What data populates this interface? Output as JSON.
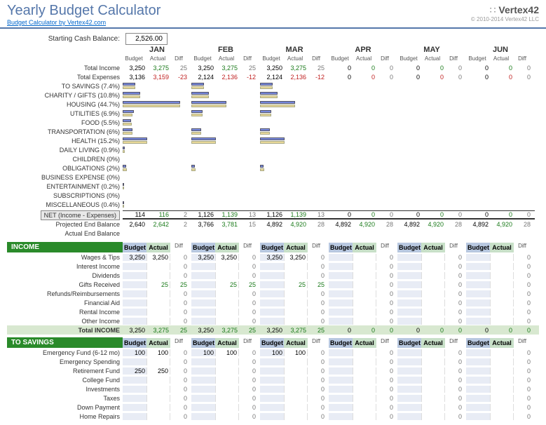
{
  "title": "Yearly Budget Calculator",
  "sublink": "Budget Calculator by Vertex42.com",
  "logo": "Vertex42",
  "copyright": "© 2010-2014 Vertex42 LLC",
  "cash_label": "Starting Cash Balance:",
  "cash_value": "2,526.00",
  "months": [
    "JAN",
    "FEB",
    "MAR",
    "APR",
    "MAY",
    "JUN"
  ],
  "col_labels": {
    "b": "Budget",
    "a": "Actual",
    "d": "Diff"
  },
  "summary": {
    "income_label": "Total Income",
    "expense_label": "Total Expenses",
    "income": [
      {
        "b": "3,250",
        "a": "3,275",
        "d": "25"
      },
      {
        "b": "3,250",
        "a": "3,275",
        "d": "25"
      },
      {
        "b": "3,250",
        "a": "3,275",
        "d": "25"
      },
      {
        "b": "0",
        "a": "0",
        "d": "0"
      },
      {
        "b": "0",
        "a": "0",
        "d": "0"
      },
      {
        "b": "0",
        "a": "0",
        "d": "0"
      }
    ],
    "expense": [
      {
        "b": "3,136",
        "a": "3,159",
        "d": "-23"
      },
      {
        "b": "2,124",
        "a": "2,136",
        "d": "-12"
      },
      {
        "b": "2,124",
        "a": "2,136",
        "d": "-12"
      },
      {
        "b": "0",
        "a": "0",
        "d": "0"
      },
      {
        "b": "0",
        "a": "0",
        "d": "0"
      },
      {
        "b": "0",
        "a": "0",
        "d": "0"
      }
    ]
  },
  "categories": [
    {
      "name": "TO SAVINGS (7.4%)",
      "bars": [
        [
          18,
          18
        ],
        [
          18,
          18
        ],
        [
          18,
          18
        ]
      ]
    },
    {
      "name": "CHARITY / GIFTS (10.8%)",
      "bars": [
        [
          25,
          25
        ],
        [
          25,
          25
        ],
        [
          25,
          25
        ]
      ]
    },
    {
      "name": "HOUSING (44.7%)",
      "bars": [
        [
          82,
          82
        ],
        [
          50,
          50
        ],
        [
          50,
          50
        ]
      ]
    },
    {
      "name": "UTILITIES (6.9%)",
      "bars": [
        [
          16,
          14
        ],
        [
          16,
          16
        ],
        [
          16,
          16
        ]
      ]
    },
    {
      "name": "FOOD (5.5%)",
      "bars": [
        [
          12,
          13
        ],
        [
          0,
          0
        ],
        [
          0,
          0
        ]
      ]
    },
    {
      "name": "TRANSPORTATION (6%)",
      "bars": [
        [
          14,
          14
        ],
        [
          14,
          14
        ],
        [
          14,
          14
        ]
      ]
    },
    {
      "name": "HEALTH (15.2%)",
      "bars": [
        [
          35,
          35
        ],
        [
          35,
          35
        ],
        [
          35,
          35
        ]
      ]
    },
    {
      "name": "DAILY LIVING (0.9%)",
      "bars": [
        [
          3,
          3
        ],
        [
          0,
          0
        ],
        [
          0,
          0
        ]
      ]
    },
    {
      "name": "CHILDREN (0%)",
      "bars": [
        [
          0,
          0
        ],
        [
          0,
          0
        ],
        [
          0,
          0
        ]
      ]
    },
    {
      "name": "OBLIGATIONS (2%)",
      "bars": [
        [
          5,
          6
        ],
        [
          5,
          6
        ],
        [
          5,
          6
        ]
      ]
    },
    {
      "name": "BUSINESS EXPENSE (0%)",
      "bars": [
        [
          0,
          0
        ],
        [
          0,
          0
        ],
        [
          0,
          0
        ]
      ]
    },
    {
      "name": "ENTERTAINMENT (0.2%)",
      "bars": [
        [
          2,
          2
        ],
        [
          0,
          0
        ],
        [
          0,
          0
        ]
      ]
    },
    {
      "name": "SUBSCRIPTIONS (0%)",
      "bars": [
        [
          0,
          0
        ],
        [
          0,
          0
        ],
        [
          0,
          0
        ]
      ]
    },
    {
      "name": "MISCELLANEOUS (0.4%)",
      "bars": [
        [
          2,
          2
        ],
        [
          0,
          0
        ],
        [
          0,
          0
        ]
      ]
    }
  ],
  "net": {
    "label": "NET (Income - Expenses)",
    "proj_label": "Projected End Balance",
    "act_label": "Actual End Balance",
    "rows": [
      {
        "b": "114",
        "a": "116",
        "d": "2"
      },
      {
        "b": "1,126",
        "a": "1,139",
        "d": "13"
      },
      {
        "b": "1,126",
        "a": "1,139",
        "d": "13"
      },
      {
        "b": "0",
        "a": "0",
        "d": "0"
      },
      {
        "b": "0",
        "a": "0",
        "d": "0"
      },
      {
        "b": "0",
        "a": "0",
        "d": "0"
      }
    ],
    "proj": [
      {
        "b": "2,640",
        "a": "2,642",
        "d": "2"
      },
      {
        "b": "3,766",
        "a": "3,781",
        "d": "15"
      },
      {
        "b": "4,892",
        "a": "4,920",
        "d": "28"
      },
      {
        "b": "4,892",
        "a": "4,920",
        "d": "28"
      },
      {
        "b": "4,892",
        "a": "4,920",
        "d": "28"
      },
      {
        "b": "4,892",
        "a": "4,920",
        "d": "28"
      }
    ]
  },
  "income_section": {
    "title": "INCOME",
    "total_label": "Total INCOME",
    "items": [
      "Wages & Tips",
      "Interest Income",
      "Dividends",
      "Gifts Received",
      "Refunds/Reimbursements",
      "Financial Aid",
      "Rental Income",
      "Other Income"
    ],
    "data": [
      [
        {
          "b": "3,250",
          "a": "3,250",
          "d": "0"
        },
        {
          "b": "3,250",
          "a": "3,250",
          "d": "0"
        },
        {
          "b": "3,250",
          "a": "3,250",
          "d": "0"
        },
        {
          "b": "",
          "a": "",
          "d": "0"
        },
        {
          "b": "",
          "a": "",
          "d": "0"
        },
        {
          "b": "",
          "a": "",
          "d": "0"
        }
      ],
      [
        {
          "b": "",
          "a": "",
          "d": "0"
        },
        {
          "b": "",
          "a": "",
          "d": "0"
        },
        {
          "b": "",
          "a": "",
          "d": "0"
        },
        {
          "b": "",
          "a": "",
          "d": "0"
        },
        {
          "b": "",
          "a": "",
          "d": "0"
        },
        {
          "b": "",
          "a": "",
          "d": "0"
        }
      ],
      [
        {
          "b": "",
          "a": "",
          "d": "0"
        },
        {
          "b": "",
          "a": "",
          "d": "0"
        },
        {
          "b": "",
          "a": "",
          "d": "0"
        },
        {
          "b": "",
          "a": "",
          "d": "0"
        },
        {
          "b": "",
          "a": "",
          "d": "0"
        },
        {
          "b": "",
          "a": "",
          "d": "0"
        }
      ],
      [
        {
          "b": "",
          "a": "25",
          "d": "25"
        },
        {
          "b": "",
          "a": "25",
          "d": "25"
        },
        {
          "b": "",
          "a": "25",
          "d": "25"
        },
        {
          "b": "",
          "a": "",
          "d": "0"
        },
        {
          "b": "",
          "a": "",
          "d": "0"
        },
        {
          "b": "",
          "a": "",
          "d": "0"
        }
      ],
      [
        {
          "b": "",
          "a": "",
          "d": "0"
        },
        {
          "b": "",
          "a": "",
          "d": "0"
        },
        {
          "b": "",
          "a": "",
          "d": "0"
        },
        {
          "b": "",
          "a": "",
          "d": "0"
        },
        {
          "b": "",
          "a": "",
          "d": "0"
        },
        {
          "b": "",
          "a": "",
          "d": "0"
        }
      ],
      [
        {
          "b": "",
          "a": "",
          "d": "0"
        },
        {
          "b": "",
          "a": "",
          "d": "0"
        },
        {
          "b": "",
          "a": "",
          "d": "0"
        },
        {
          "b": "",
          "a": "",
          "d": "0"
        },
        {
          "b": "",
          "a": "",
          "d": "0"
        },
        {
          "b": "",
          "a": "",
          "d": "0"
        }
      ],
      [
        {
          "b": "",
          "a": "",
          "d": "0"
        },
        {
          "b": "",
          "a": "",
          "d": "0"
        },
        {
          "b": "",
          "a": "",
          "d": "0"
        },
        {
          "b": "",
          "a": "",
          "d": "0"
        },
        {
          "b": "",
          "a": "",
          "d": "0"
        },
        {
          "b": "",
          "a": "",
          "d": "0"
        }
      ],
      [
        {
          "b": "",
          "a": "",
          "d": "0"
        },
        {
          "b": "",
          "a": "",
          "d": "0"
        },
        {
          "b": "",
          "a": "",
          "d": "0"
        },
        {
          "b": "",
          "a": "",
          "d": "0"
        },
        {
          "b": "",
          "a": "",
          "d": "0"
        },
        {
          "b": "",
          "a": "",
          "d": "0"
        }
      ]
    ],
    "totals": [
      {
        "b": "3,250",
        "a": "3,275",
        "d": "25"
      },
      {
        "b": "3,250",
        "a": "3,275",
        "d": "25"
      },
      {
        "b": "3,250",
        "a": "3,275",
        "d": "25"
      },
      {
        "b": "0",
        "a": "0",
        "d": "0"
      },
      {
        "b": "0",
        "a": "0",
        "d": "0"
      },
      {
        "b": "0",
        "a": "0",
        "d": "0"
      }
    ]
  },
  "savings_section": {
    "title": "TO SAVINGS",
    "items": [
      "Emergency Fund (6-12 mo)",
      "Emergency Spending",
      "Retirement Fund",
      "College Fund",
      "Investments",
      "Taxes",
      "Down Payment",
      "Home Repairs"
    ],
    "data": [
      [
        {
          "b": "100",
          "a": "100",
          "d": "0"
        },
        {
          "b": "100",
          "a": "100",
          "d": "0"
        },
        {
          "b": "100",
          "a": "100",
          "d": "0"
        },
        {
          "b": "",
          "a": "",
          "d": "0"
        },
        {
          "b": "",
          "a": "",
          "d": "0"
        },
        {
          "b": "",
          "a": "",
          "d": "0"
        }
      ],
      [
        {
          "b": "",
          "a": "",
          "d": "0"
        },
        {
          "b": "",
          "a": "",
          "d": "0"
        },
        {
          "b": "",
          "a": "",
          "d": "0"
        },
        {
          "b": "",
          "a": "",
          "d": "0"
        },
        {
          "b": "",
          "a": "",
          "d": "0"
        },
        {
          "b": "",
          "a": "",
          "d": "0"
        }
      ],
      [
        {
          "b": "250",
          "a": "250",
          "d": "0"
        },
        {
          "b": "",
          "a": "",
          "d": "0"
        },
        {
          "b": "",
          "a": "",
          "d": "0"
        },
        {
          "b": "",
          "a": "",
          "d": "0"
        },
        {
          "b": "",
          "a": "",
          "d": "0"
        },
        {
          "b": "",
          "a": "",
          "d": "0"
        }
      ],
      [
        {
          "b": "",
          "a": "",
          "d": "0"
        },
        {
          "b": "",
          "a": "",
          "d": "0"
        },
        {
          "b": "",
          "a": "",
          "d": "0"
        },
        {
          "b": "",
          "a": "",
          "d": "0"
        },
        {
          "b": "",
          "a": "",
          "d": "0"
        },
        {
          "b": "",
          "a": "",
          "d": "0"
        }
      ],
      [
        {
          "b": "",
          "a": "",
          "d": "0"
        },
        {
          "b": "",
          "a": "",
          "d": "0"
        },
        {
          "b": "",
          "a": "",
          "d": "0"
        },
        {
          "b": "",
          "a": "",
          "d": "0"
        },
        {
          "b": "",
          "a": "",
          "d": "0"
        },
        {
          "b": "",
          "a": "",
          "d": "0"
        }
      ],
      [
        {
          "b": "",
          "a": "",
          "d": "0"
        },
        {
          "b": "",
          "a": "",
          "d": "0"
        },
        {
          "b": "",
          "a": "",
          "d": "0"
        },
        {
          "b": "",
          "a": "",
          "d": "0"
        },
        {
          "b": "",
          "a": "",
          "d": "0"
        },
        {
          "b": "",
          "a": "",
          "d": "0"
        }
      ],
      [
        {
          "b": "",
          "a": "",
          "d": "0"
        },
        {
          "b": "",
          "a": "",
          "d": "0"
        },
        {
          "b": "",
          "a": "",
          "d": "0"
        },
        {
          "b": "",
          "a": "",
          "d": "0"
        },
        {
          "b": "",
          "a": "",
          "d": "0"
        },
        {
          "b": "",
          "a": "",
          "d": "0"
        }
      ],
      [
        {
          "b": "",
          "a": "",
          "d": "0"
        },
        {
          "b": "",
          "a": "",
          "d": "0"
        },
        {
          "b": "",
          "a": "",
          "d": "0"
        },
        {
          "b": "",
          "a": "",
          "d": "0"
        },
        {
          "b": "",
          "a": "",
          "d": "0"
        },
        {
          "b": "",
          "a": "",
          "d": "0"
        }
      ]
    ]
  }
}
